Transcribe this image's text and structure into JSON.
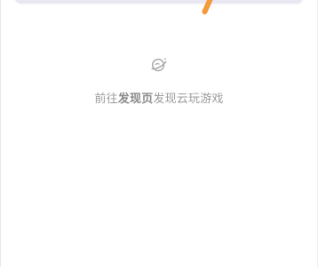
{
  "empty_state": {
    "icon": "planet-icon",
    "hint_prefix": "前往",
    "hint_link": "发现页",
    "hint_suffix": "发现云玩游戏"
  },
  "colors": {
    "accent": "#f39a3a",
    "muted_text": "#9b9b9b",
    "card_bg": "#e9e8f2"
  }
}
